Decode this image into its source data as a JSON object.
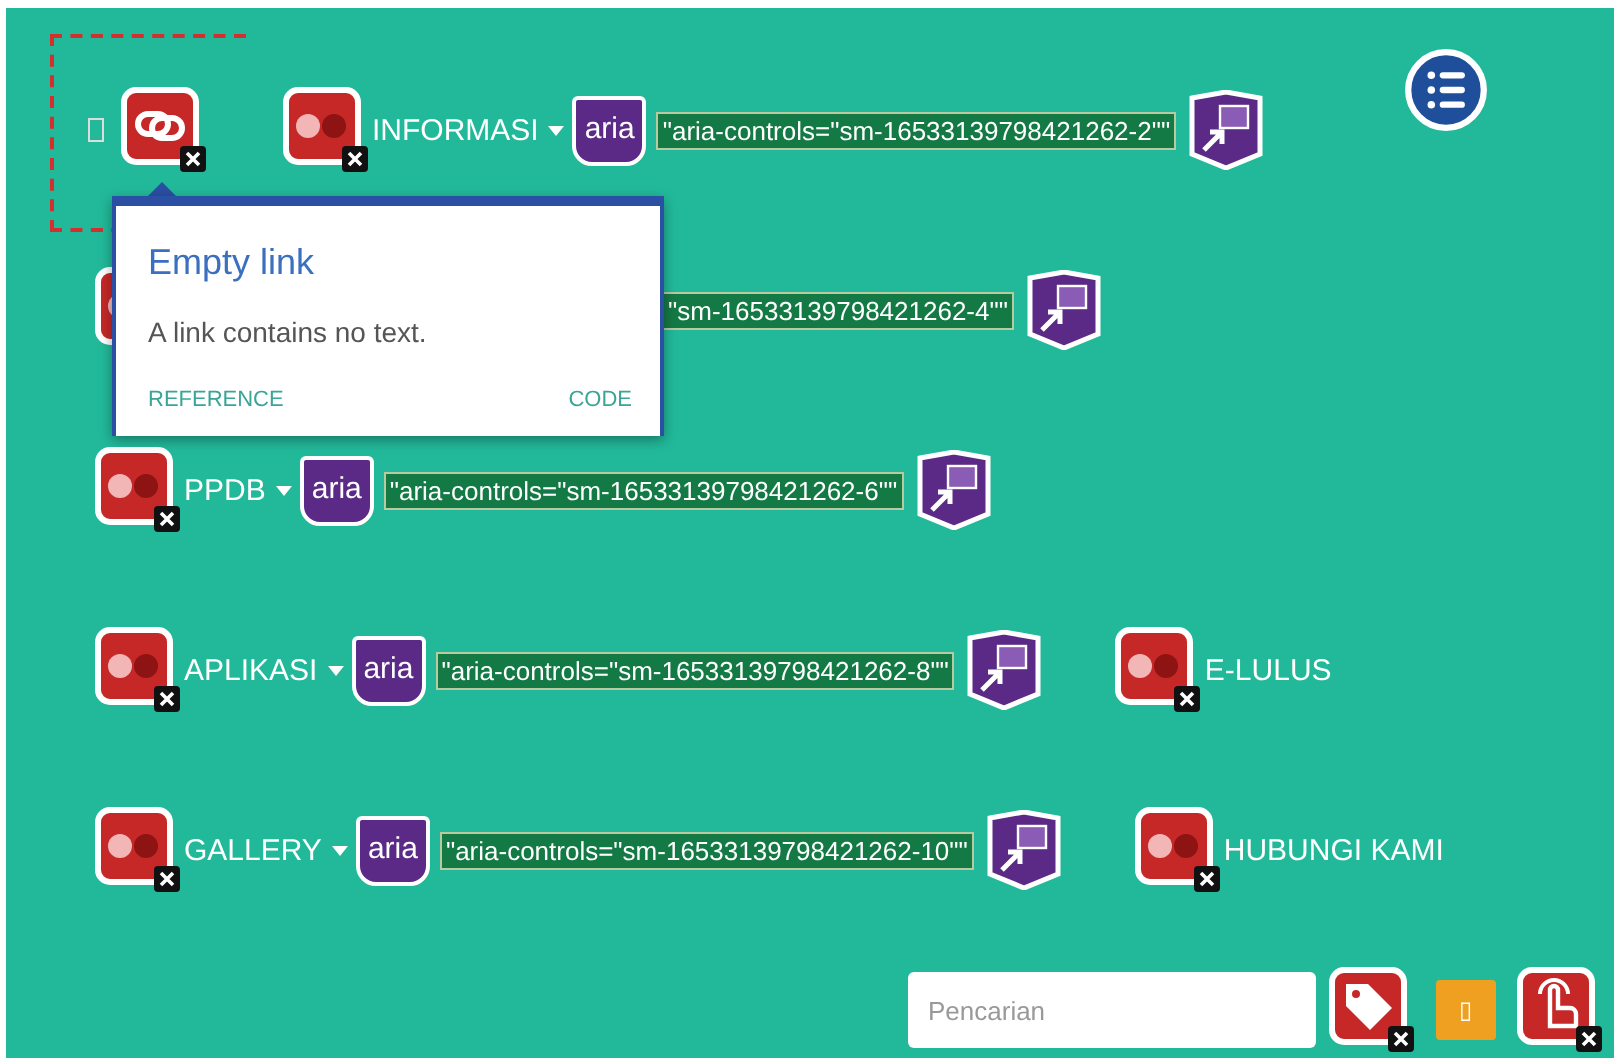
{
  "rows": [
    {
      "empty_link": true,
      "menu": {
        "label": "INFORMASI",
        "aria_badge": "aria",
        "aria_text": "\"aria-controls=\"sm-16533139798421262-2\"\""
      }
    },
    {
      "covered": true,
      "menu": {
        "aria_text": "\"sm-16533139798421262-4\"\""
      }
    },
    {
      "menu": {
        "label": "PPDB",
        "aria_badge": "aria",
        "aria_text": "\"aria-controls=\"sm-16533139798421262-6\"\""
      }
    },
    {
      "menu": {
        "label": "APLIKASI",
        "aria_badge": "aria",
        "aria_text": "\"aria-controls=\"sm-16533139798421262-8\"\""
      },
      "link": {
        "label": "E-LULUS"
      }
    },
    {
      "menu": {
        "label": "GALLERY",
        "aria_badge": "aria",
        "aria_text": "\"aria-controls=\"sm-16533139798421262-10\"\""
      },
      "link": {
        "label": "HUBUNGI KAMI"
      }
    }
  ],
  "tooltip": {
    "title": "Empty link",
    "text": "A link contains no text.",
    "links": [
      "REFERENCE",
      "CODE"
    ]
  },
  "search": {
    "placeholder": "Pencarian"
  },
  "orange_button": "▯"
}
